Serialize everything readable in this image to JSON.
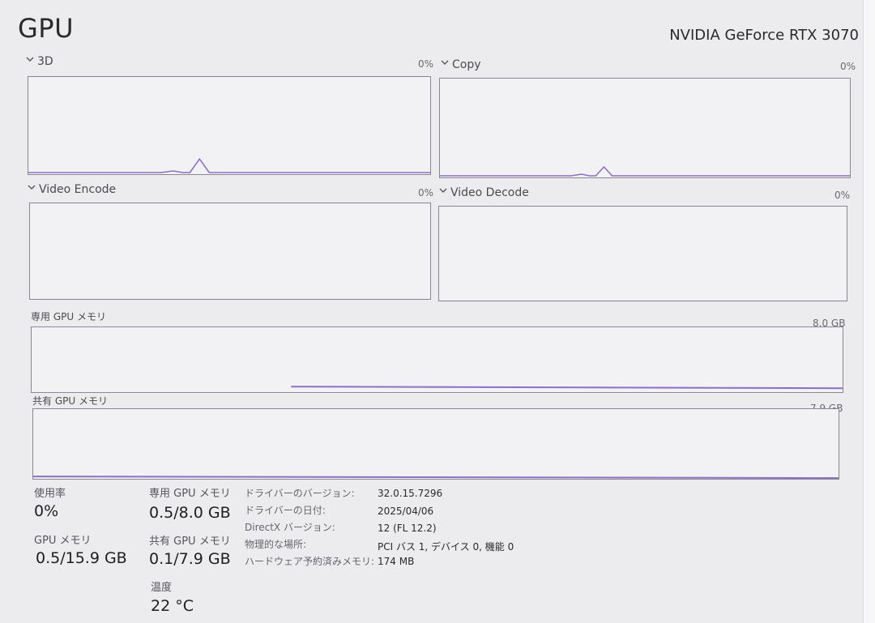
{
  "header": {
    "title": "GPU",
    "device_name": "NVIDIA GeForce RTX 3070"
  },
  "graphs": {
    "3d": {
      "label": "3D",
      "max": "0%",
      "peak": 0.14
    },
    "copy": {
      "label": "Copy",
      "max": "0%",
      "peak": 0.09
    },
    "video_encode": {
      "label": "Video Encode",
      "max": "0%"
    },
    "video_decode": {
      "label": "Video Decode",
      "max": "0%"
    },
    "dedicated_memory": {
      "label": "専用 GPU メモリ",
      "max": "8.0 GB",
      "usage_fraction": 0.06
    },
    "shared_memory": {
      "label": "共有 GPU メモリ",
      "max": "7.9 GB",
      "usage_fraction": 0.01
    }
  },
  "stats": {
    "utilization": {
      "label": "使用率",
      "value": "0%"
    },
    "gpu_memory": {
      "label": "GPU メモリ",
      "value": "0.5/15.9 GB"
    },
    "dedicated_memory": {
      "label": "専用 GPU メモリ",
      "value": "0.5/8.0 GB"
    },
    "shared_memory": {
      "label": "共有 GPU メモリ",
      "value": "0.1/7.9 GB"
    },
    "temperature": {
      "label": "温度",
      "value": "22 °C"
    }
  },
  "info": [
    {
      "key": "ドライバーのバージョン:",
      "value": "32.0.15.7296"
    },
    {
      "key": "ドライバーの日付:",
      "value": "2025/04/06"
    },
    {
      "key": "DirectX バージョン:",
      "value": "12 (FL 12.2)"
    },
    {
      "key": "物理的な場所:",
      "value": "PCI バス 1, デバイス 0, 機能 0"
    },
    {
      "key": "ハードウェア予約済みメモリ:",
      "value": "174 MB"
    }
  ],
  "colors": {
    "graph_line": "#8e6fc0",
    "graph_border": "#8a8794",
    "background": "#ecebee"
  }
}
